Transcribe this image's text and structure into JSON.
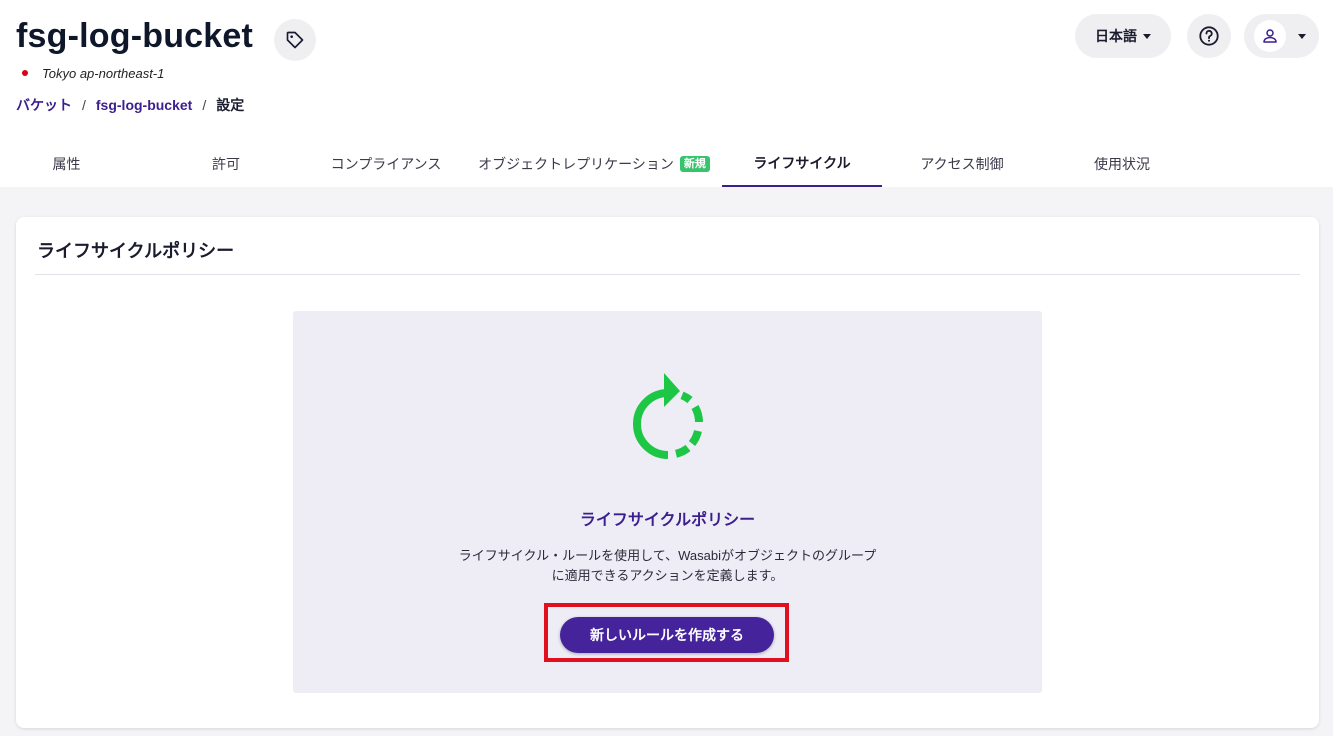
{
  "bucket": {
    "name": "fsg-log-bucket",
    "region": "Tokyo ap-northeast-1"
  },
  "breadcrumb": {
    "items": [
      "バケット",
      "fsg-log-bucket",
      "設定"
    ],
    "separator": "/"
  },
  "header_controls": {
    "language_label": "日本語"
  },
  "tabs": [
    {
      "label": "属性"
    },
    {
      "label": "許可"
    },
    {
      "label": "コンプライアンス"
    },
    {
      "label": "オブジェクトレプリケーション",
      "badge": "新規"
    },
    {
      "label": "ライフサイクル",
      "active": true
    },
    {
      "label": "アクセス制御"
    },
    {
      "label": "使用状況"
    }
  ],
  "card": {
    "title": "ライフサイクルポリシー",
    "empty_state": {
      "title": "ライフサイクルポリシー",
      "description": "ライフサイクル・ルールを使用して、Wasabiがオブジェクトのグループに適用できるアクションを定義します。",
      "button_label": "新しいルールを作成する"
    }
  },
  "colors": {
    "primary": "#3b1f8e",
    "button": "#45239a",
    "cycle_icon": "#1ec646",
    "new_badge": "#37c46c",
    "highlight": "#e0101e"
  },
  "icons": {
    "tag": "tag-icon",
    "help": "help-circle-icon",
    "user": "user-icon",
    "lifecycle": "cycle-arrow-icon"
  }
}
